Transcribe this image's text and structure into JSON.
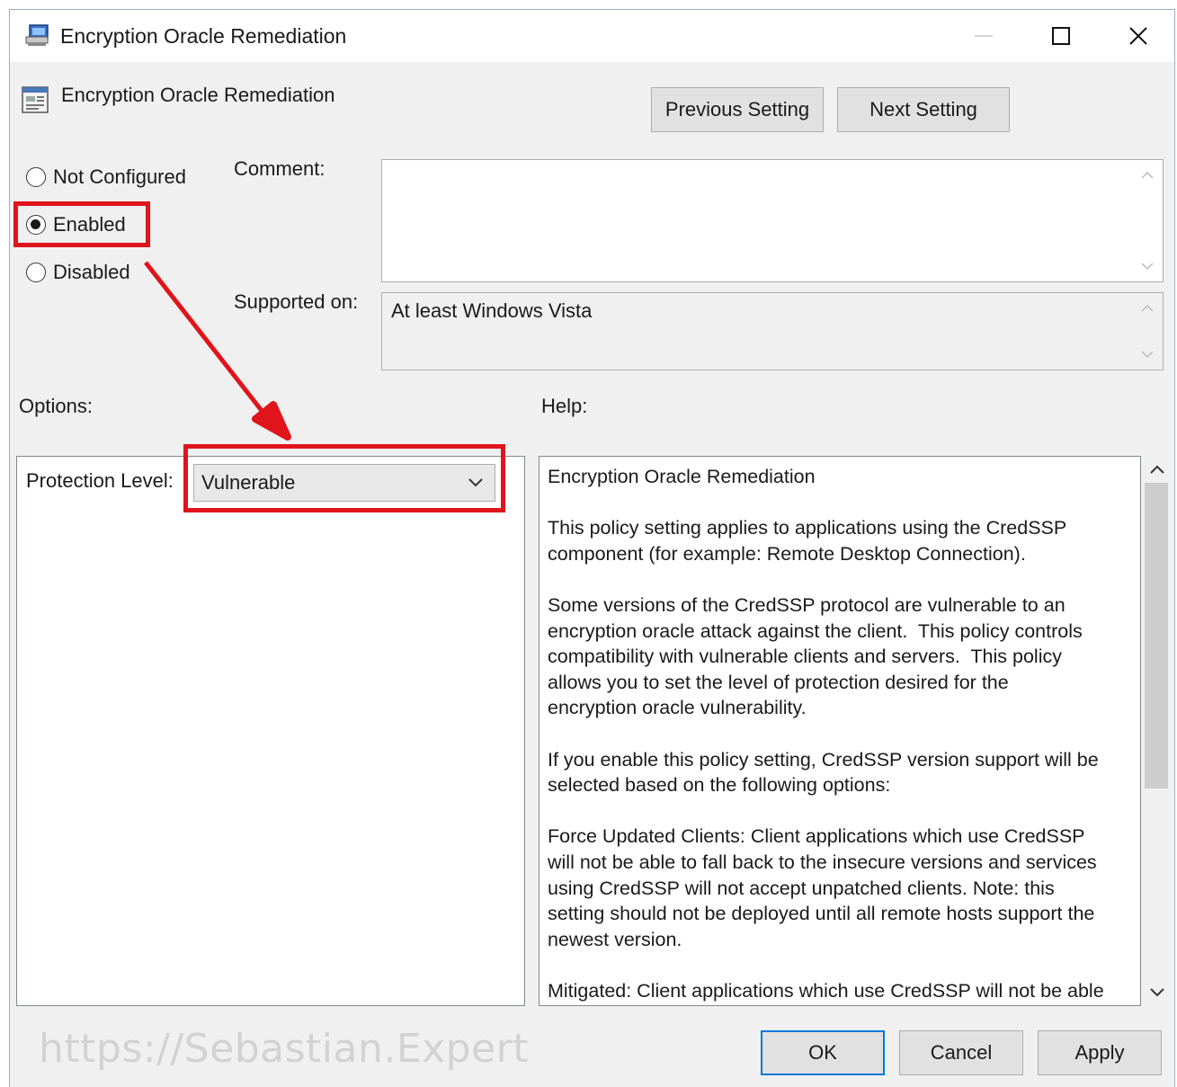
{
  "window": {
    "title": "Encryption Oracle Remediation"
  },
  "header": {
    "policy_name": "Encryption Oracle Remediation",
    "previous_setting": "Previous Setting",
    "next_setting": "Next Setting"
  },
  "state": {
    "options": [
      "Not Configured",
      "Enabled",
      "Disabled"
    ],
    "selected": "Enabled"
  },
  "comment": {
    "label": "Comment:",
    "value": ""
  },
  "supported": {
    "label": "Supported on:",
    "value": "At least Windows Vista"
  },
  "options_section": {
    "label": "Options:",
    "protection_label": "Protection Level:",
    "protection_value": "Vulnerable"
  },
  "help_section": {
    "label": "Help:",
    "text": "Encryption Oracle Remediation\n\nThis policy setting applies to applications using the CredSSP\ncomponent (for example: Remote Desktop Connection).\n\nSome versions of the CredSSP protocol are vulnerable to an\nencryption oracle attack against the client.  This policy controls\ncompatibility with vulnerable clients and servers.  This policy\nallows you to set the level of protection desired for the\nencryption oracle vulnerability.\n\nIf you enable this policy setting, CredSSP version support will be\nselected based on the following options:\n\nForce Updated Clients: Client applications which use CredSSP\nwill not be able to fall back to the insecure versions and services\nusing CredSSP will not accept unpatched clients. Note: this\nsetting should not be deployed until all remote hosts support the\nnewest version.\n\nMitigated: Client applications which use CredSSP will not be able"
  },
  "footer": {
    "ok": "OK",
    "cancel": "Cancel",
    "apply": "Apply",
    "watermark": "https://Sebastian.Expert"
  },
  "icons": {
    "window": "policy-computer-icon",
    "setting": "policy-setting-icon"
  },
  "colors": {
    "highlight_red": "#e0141b",
    "default_button_border": "#0078d7",
    "dialog_bg": "#f0f0f0"
  }
}
